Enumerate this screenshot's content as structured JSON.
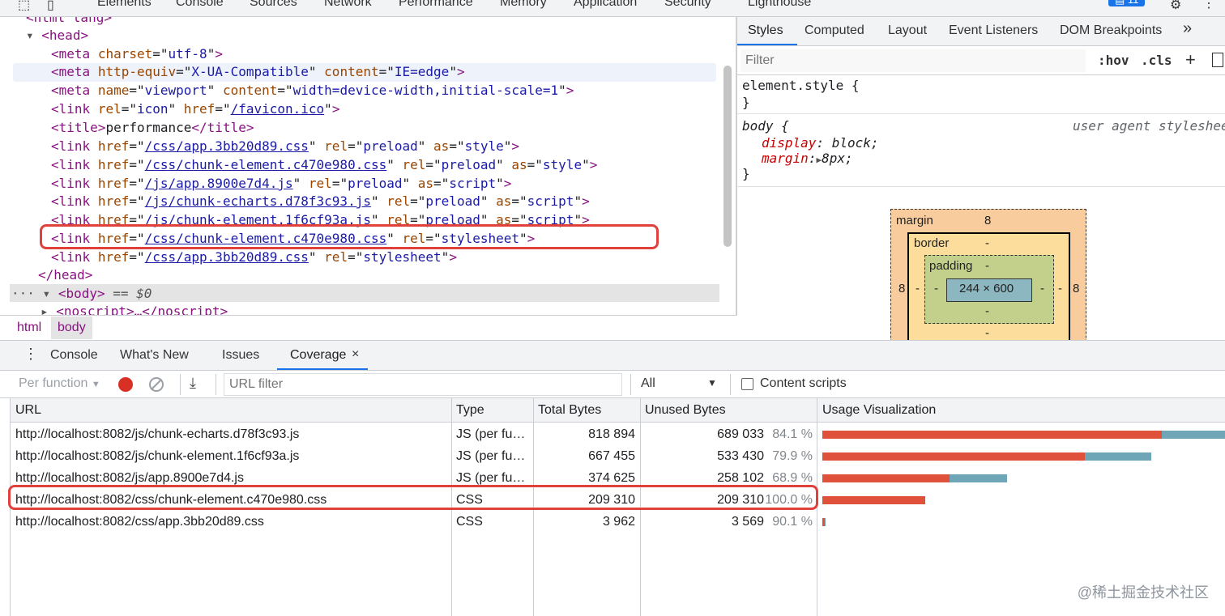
{
  "top_tabs": [
    "Elements",
    "Console",
    "Sources",
    "Network",
    "Performance",
    "Memory",
    "Application",
    "Security",
    "Lighthouse"
  ],
  "issues_badge": "11",
  "dom": {
    "line0": "<html lang>",
    "head_open": "<head>",
    "meta_charset": {
      "tag": "<meta",
      "attr": "charset",
      "val": "utf-8",
      "end": ">"
    },
    "meta_equiv": {
      "tag": "<meta",
      "attr1": "http-equiv",
      "val1": "X-UA-Compatible",
      "attr2": "content",
      "val2": "IE=edge",
      "end": ">"
    },
    "meta_viewport": {
      "tag": "<meta",
      "attr1": "name",
      "val1": "viewport",
      "attr2": "content",
      "val2": "width=device-width,initial-scale=1",
      "end": ">"
    },
    "link_icon": {
      "tag": "<link",
      "attr1": "rel",
      "val1": "icon",
      "attr2": "href",
      "val2": "/favicon.ico",
      "end": ">"
    },
    "title": {
      "open": "<title>",
      "text": "performance",
      "close": "</title>"
    },
    "preloads": [
      {
        "href": "/css/app.3bb20d89.css",
        "as": "style"
      },
      {
        "href": "/css/chunk-element.c470e980.css",
        "as": "style"
      },
      {
        "href": "/js/app.8900e7d4.js",
        "as": "script"
      },
      {
        "href": "/js/chunk-echarts.d78f3c93.js",
        "as": "script"
      },
      {
        "href": "/js/chunk-element.1f6cf93a.js",
        "as": "script"
      }
    ],
    "stylesheets": [
      {
        "href": "/css/chunk-element.c470e980.css"
      },
      {
        "href": "/css/app.3bb20d89.css"
      }
    ],
    "head_close": "</head>",
    "body_open": "<body>",
    "body_sel": "== $0",
    "noscript": "<noscript>…</noscript>",
    "link_word": "<link",
    "href_word": "href",
    "rel_word": "rel",
    "as_word": "as",
    "preload_word": "preload",
    "stylesheet_word": "stylesheet"
  },
  "breadcrumbs": [
    "html",
    "body"
  ],
  "styles_tabs": [
    "Styles",
    "Computed",
    "Layout",
    "Event Listeners",
    "DOM Breakpoints"
  ],
  "styles_more": "»",
  "styles_filter_placeholder": "Filter",
  "styles_hov": ":hov",
  "styles_cls": ".cls",
  "styles_plus": "+",
  "rules": {
    "element_style": "element.style {",
    "close": "}",
    "body_sel": "body {",
    "ua": "user agent stylesheet",
    "display_prop": "display",
    "display_val": "block;",
    "margin_prop": "margin",
    "margin_val": "8px;"
  },
  "box_model": {
    "margin_label": "margin",
    "margin_top": "8",
    "margin_left": "8",
    "margin_right": "8",
    "border_label": "border",
    "border_top": "-",
    "border_left": "-",
    "border_right": "-",
    "border_bottom": "-",
    "padding_label": "padding",
    "padding_top": "-",
    "padding_left": "-",
    "padding_right": "-",
    "padding_bottom": "-",
    "content": "244 × 600"
  },
  "drawer_tabs": [
    "Console",
    "What's New",
    "Issues",
    "Coverage"
  ],
  "drawer_close": "×",
  "coverage": {
    "per_function": "Per function",
    "url_filter_placeholder": "URL filter",
    "type_select": "All",
    "content_scripts": "Content scripts",
    "headers": [
      "URL",
      "Type",
      "Total Bytes",
      "Unused Bytes",
      "Usage Visualization"
    ],
    "rows": [
      {
        "url": "http://localhost:8082/js/chunk-echarts.d78f3c93.js",
        "type": "JS (per fu…",
        "total": "818 894",
        "unused": "689 033",
        "pct": "84.1 %",
        "unused_frac": 0.841,
        "total_frac": 1.0
      },
      {
        "url": "http://localhost:8082/js/chunk-element.1f6cf93a.js",
        "type": "JS (per fu…",
        "total": "667 455",
        "unused": "533 430",
        "pct": "79.9 %",
        "unused_frac": 0.799,
        "total_frac": 0.815
      },
      {
        "url": "http://localhost:8082/js/app.8900e7d4.js",
        "type": "JS (per fu…",
        "total": "374 625",
        "unused": "258 102",
        "pct": "68.9 %",
        "unused_frac": 0.689,
        "total_frac": 0.457
      },
      {
        "url": "http://localhost:8082/css/chunk-element.c470e980.css",
        "type": "CSS",
        "total": "209 310",
        "unused": "209 310",
        "pct": "100.0 %",
        "unused_frac": 1.0,
        "total_frac": 0.256
      },
      {
        "url": "http://localhost:8082/css/app.3bb20d89.css",
        "type": "CSS",
        "total": "3 962",
        "unused": "3 569",
        "pct": "90.1 %",
        "unused_frac": 0.901,
        "total_frac": 0.005
      }
    ]
  },
  "colors": {
    "unused": "#e0513b",
    "used": "#6ea6b8",
    "highlight": "#e0413b"
  },
  "watermark": "@稀土掘金技术社区"
}
